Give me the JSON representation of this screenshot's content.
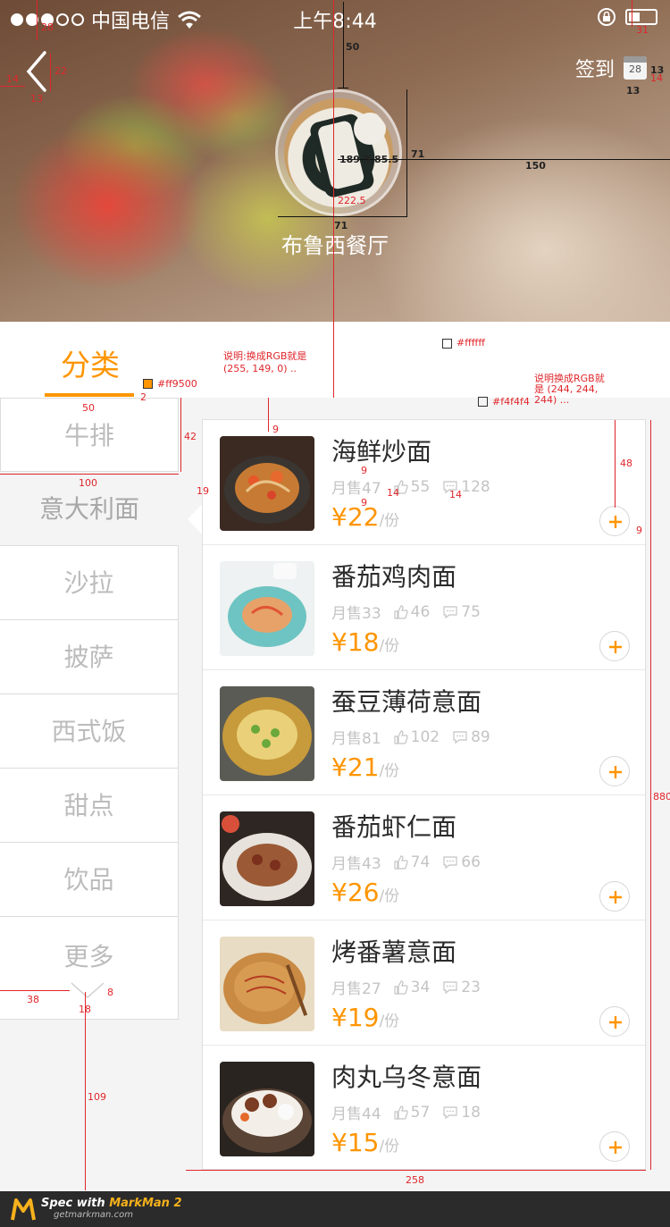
{
  "status_bar": {
    "carrier": "中国电信",
    "time": "上午8:44"
  },
  "header": {
    "checkin_label": "签到",
    "calendar_day": "28",
    "restaurant_name": "布鲁西餐厅"
  },
  "category": {
    "title": "分类",
    "items": [
      "牛排",
      "意大利面",
      "沙拉",
      "披萨",
      "西式饭",
      "甜点",
      "饮品",
      "更多"
    ],
    "active_index": 1
  },
  "dishes": [
    {
      "name": "海鲜炒面",
      "sold": "月售47",
      "likes": "55",
      "comments": "128",
      "price": "¥22",
      "unit": "/份"
    },
    {
      "name": "番茄鸡肉面",
      "sold": "月售33",
      "likes": "46",
      "comments": "75",
      "price": "¥18",
      "unit": "/份"
    },
    {
      "name": "蚕豆薄荷意面",
      "sold": "月售81",
      "likes": "102",
      "comments": "89",
      "price": "¥21",
      "unit": "/份"
    },
    {
      "name": "番茄虾仁面",
      "sold": "月售43",
      "likes": "74",
      "comments": "66",
      "price": "¥26",
      "unit": "/份"
    },
    {
      "name": "烤番薯意面",
      "sold": "月售27",
      "likes": "34",
      "comments": "23",
      "price": "¥19",
      "unit": "/份"
    },
    {
      "name": "肉丸乌冬意面",
      "sold": "月售44",
      "likes": "57",
      "comments": "18",
      "price": "¥15",
      "unit": "/份"
    }
  ],
  "annotations": {
    "status_h": "28",
    "status_right": "31",
    "back_w": "14",
    "back_h": "22",
    "back_bottom": "13",
    "top_gap": "50",
    "cal_w": "13",
    "cal_h": "13",
    "cal_right": "14",
    "logo_pos": "189.5,85.5",
    "logo_size": "71",
    "logo_bottom": "222.5",
    "logo_right": "150",
    "logo_w": "71",
    "white_color": "#ffffff",
    "orange_color": "#ff9500",
    "orange_note": "说明:换成RGB就是 (255, 149, 0) ..",
    "gray_color": "#f4f4f4",
    "gray_note": "说明换成RGB就是 (244, 244, 244) ...",
    "underline_w": "50",
    "underline_h": "2",
    "menu_h": "42",
    "menu_w": "100",
    "pointer_h": "19",
    "list_top": "9",
    "title_gap": "9",
    "stat_gap1": "9",
    "stat_gap2": "14",
    "stat_gap3": "14",
    "right_48": "48",
    "right_9": "9",
    "list_h": "880",
    "more_left": "38",
    "more_w": "18",
    "more_h": "8",
    "bottom_gap": "109",
    "list_w": "258"
  },
  "footer": {
    "spec_text": "Spec with ",
    "brand": "MarkMan 2",
    "url": "getmarkman.com"
  },
  "colors": {
    "accent": "#ff9500",
    "background": "#f4f4f4",
    "white": "#ffffff"
  }
}
